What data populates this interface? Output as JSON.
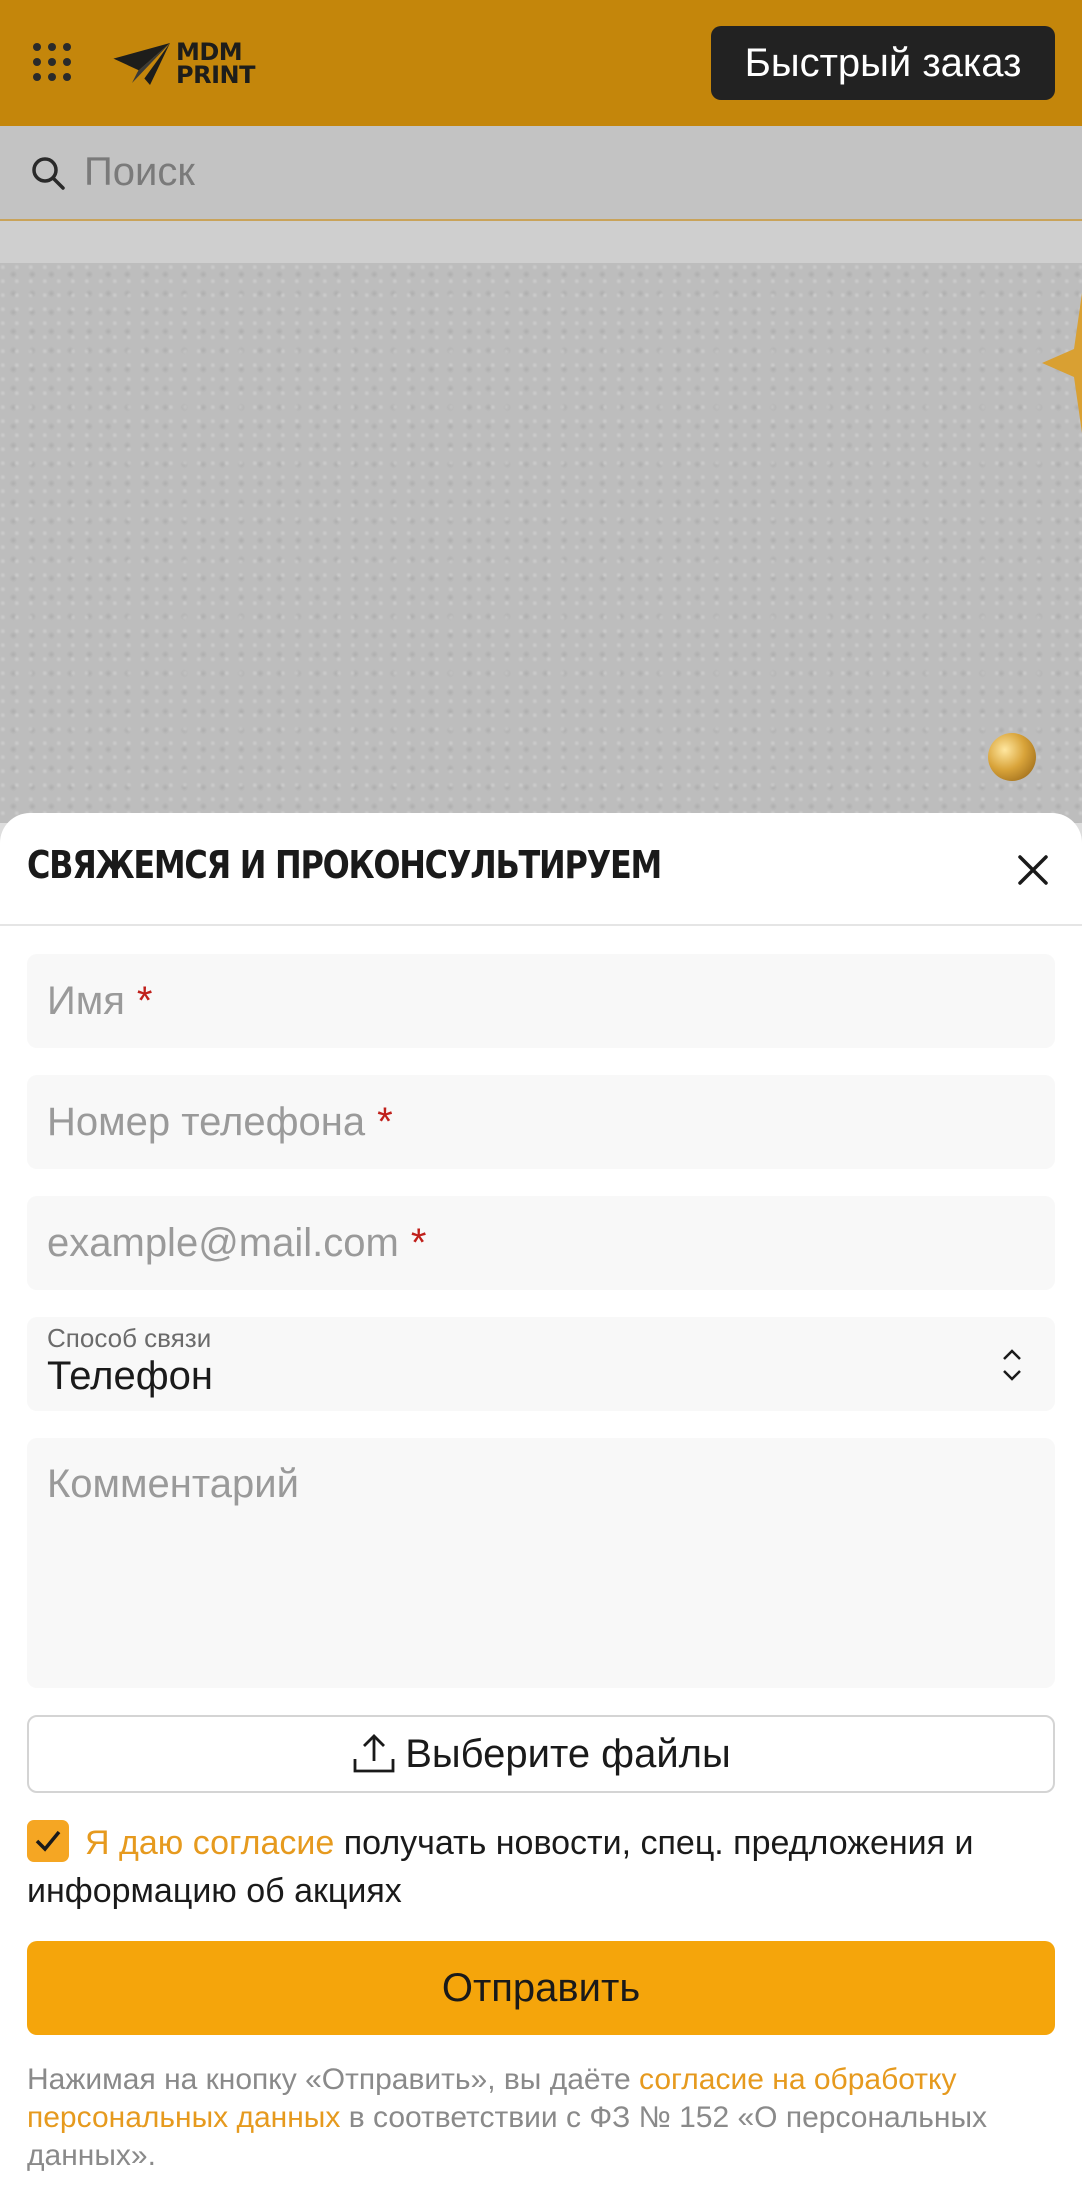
{
  "header": {
    "logo_text_line1": "MDM",
    "logo_text_line2": "PRINT",
    "quick_order_label": "Быстрый заказ",
    "background_color": "#c4860b"
  },
  "search": {
    "placeholder": "Поиск"
  },
  "modal": {
    "title": "СВЯЖЕМСЯ И ПРОКОНСУЛЬТИРУЕМ",
    "fields": {
      "name_placeholder": "Имя",
      "phone_placeholder": "Номер телефона",
      "email_placeholder": "example@mail.com",
      "required_mark": "*",
      "contact_method_label": "Способ связи",
      "contact_method_value": "Телефон",
      "comment_placeholder": "Комментарий"
    },
    "file_button_label": "Выберите файлы",
    "consent": {
      "checked": true,
      "link_text": "Я даю согласие",
      "rest_text": " получать новости, спец. предложения и информацию об акциях"
    },
    "submit_label": "Отправить",
    "legal": {
      "part1": "Нажимая на кнопку «Отправить», вы даёте ",
      "link_text": "согласие на обработку персональных данных",
      "part2": " в соответствии с ФЗ № 152 «О персональных данных»."
    }
  },
  "colors": {
    "accent": "#f5a50b",
    "link": "#e69a1e",
    "required": "#c0201b",
    "dark_button": "#222222"
  }
}
